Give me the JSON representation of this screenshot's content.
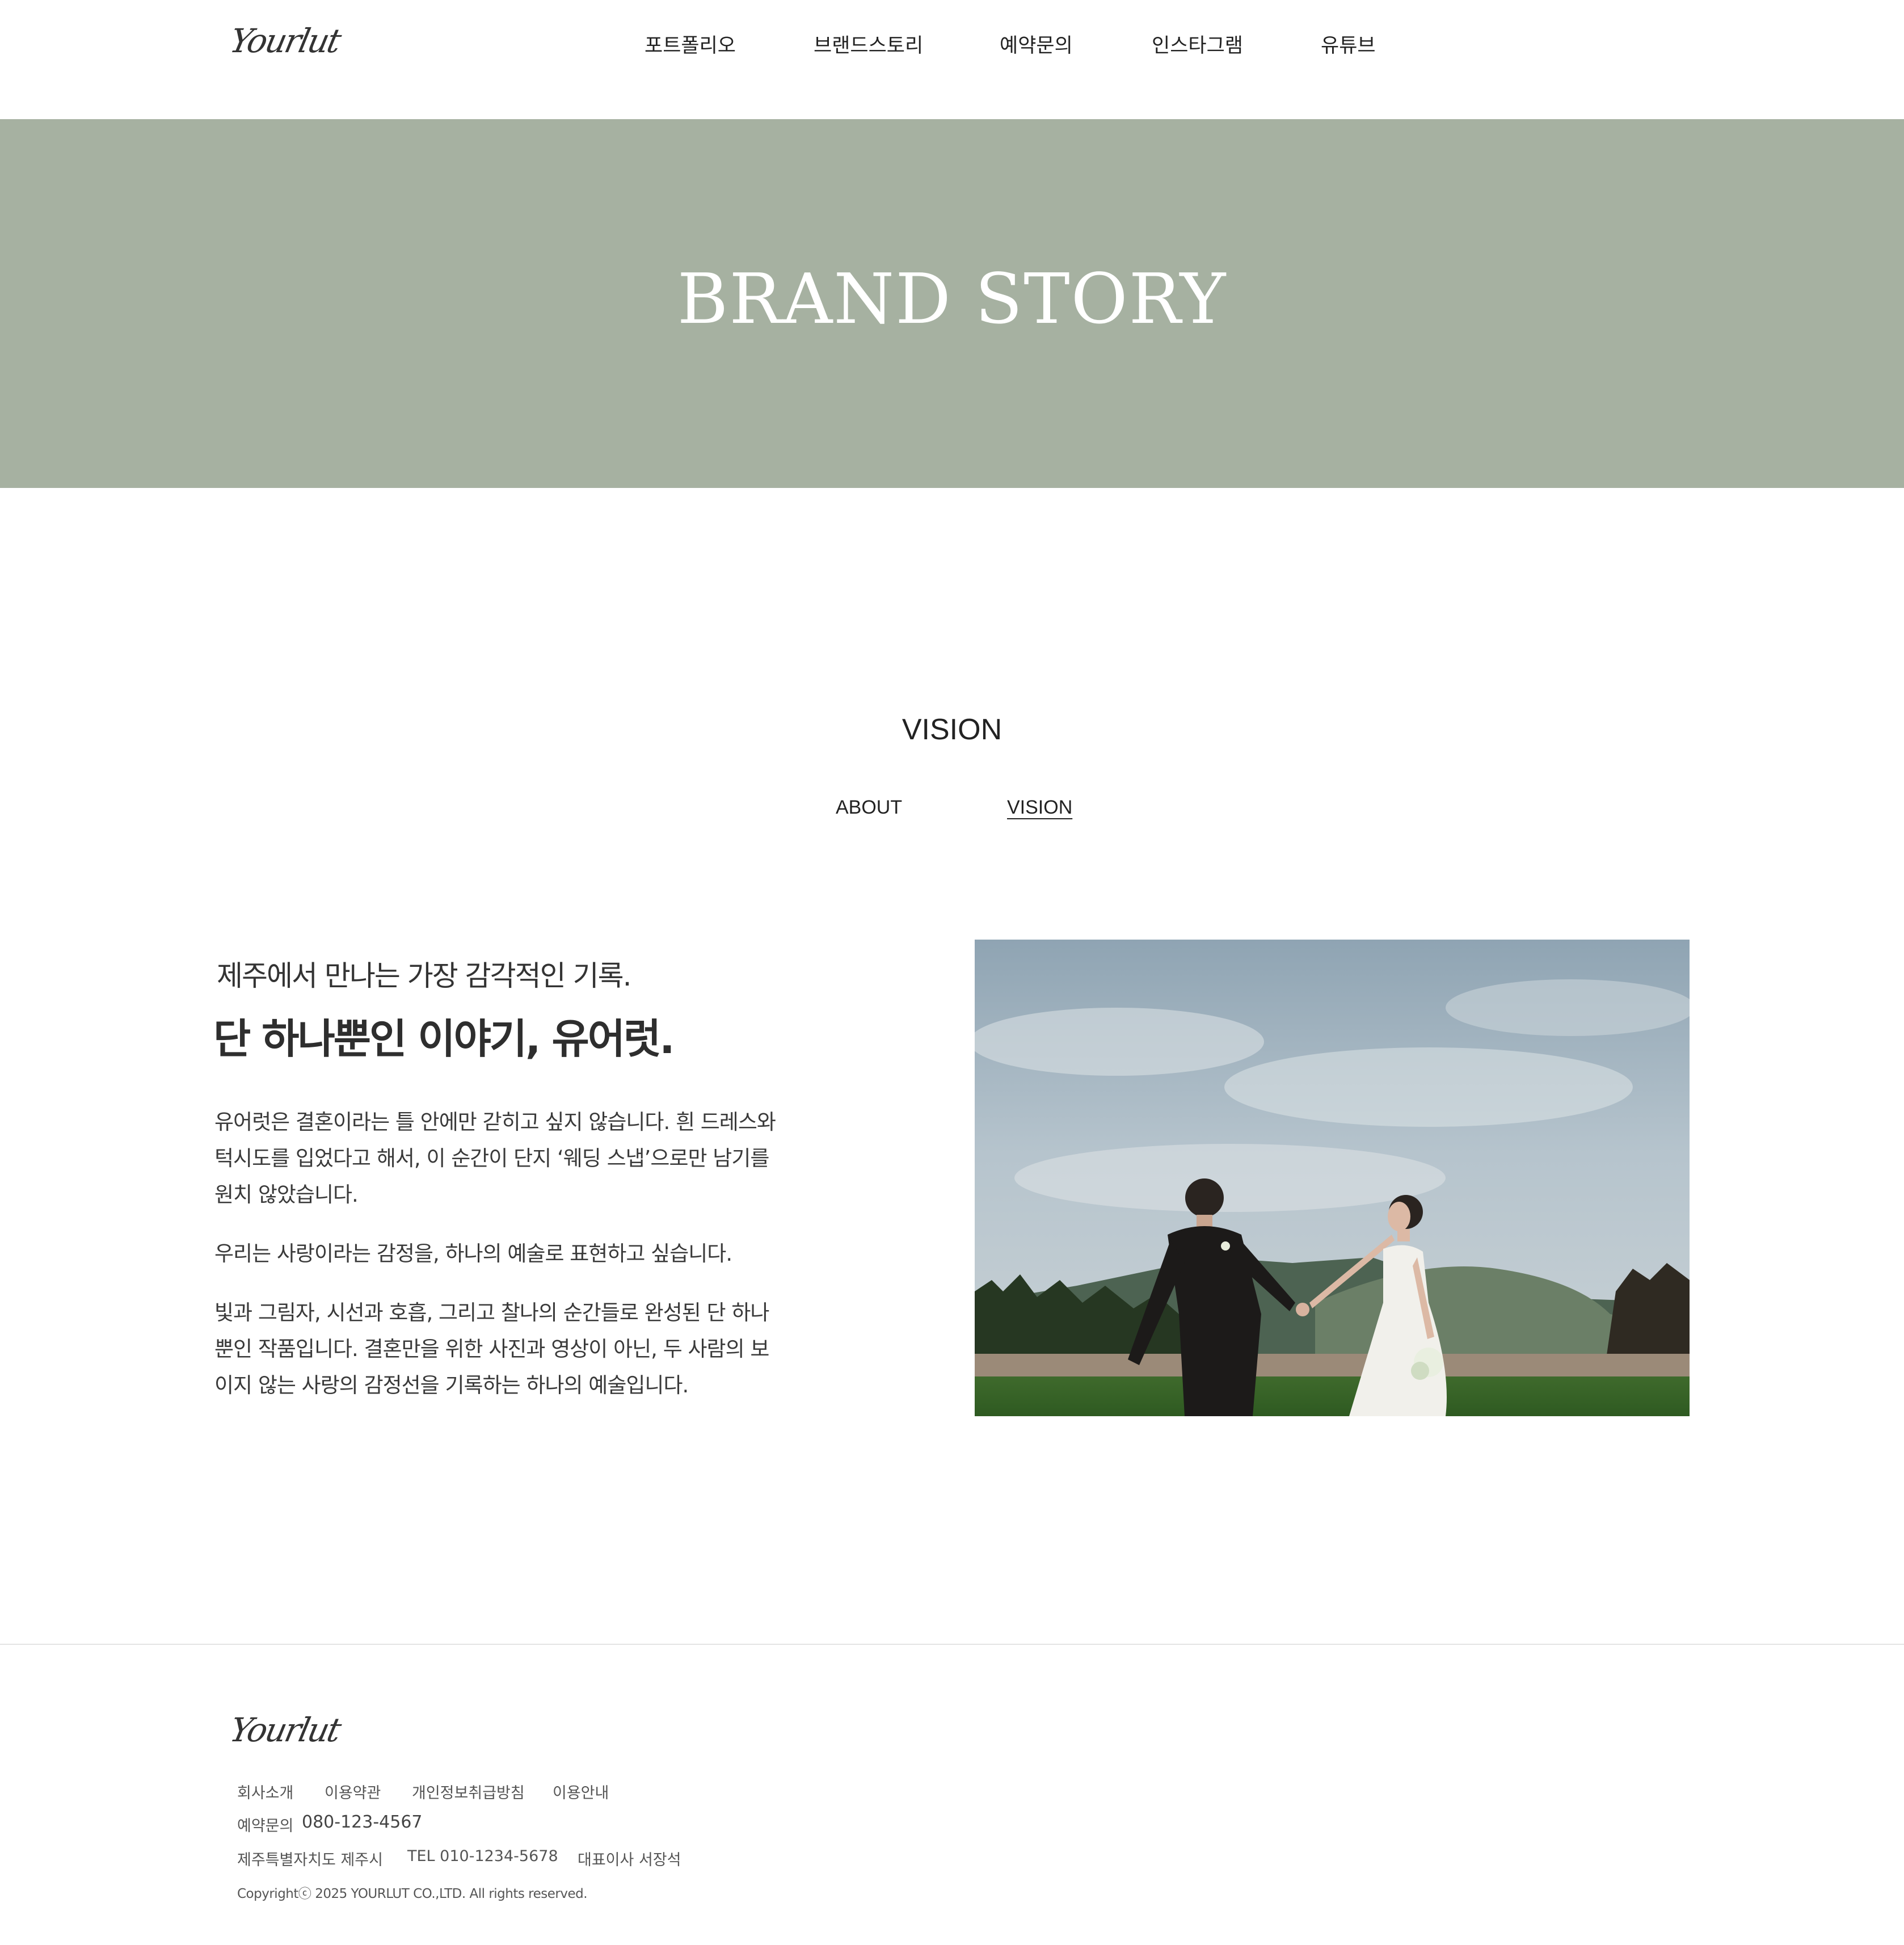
{
  "header": {
    "logo_text": "Yourlut",
    "nav": [
      "포트폴리오",
      "브랜드스토리",
      "예약문의",
      "인스타그램",
      "유튜브"
    ]
  },
  "hero": {
    "title": "BRAND STORY",
    "background_color": "#a6b1a1"
  },
  "section": {
    "title": "VISION",
    "tabs": [
      {
        "label": "ABOUT",
        "active": false
      },
      {
        "label": "VISION",
        "active": true
      }
    ]
  },
  "content": {
    "sub_heading": "제주에서 만나는 가장 감각적인 기록.",
    "main_heading": "단 하나뿐인 이야기, 유어럿.",
    "paragraphs": [
      "유어럿은 결혼이라는 틀 안에만 갇히고 싶지 않습니다. 흰 드레스와 턱시도를 입었다고 해서, 이 순간이 단지 ‘웨딩 스냅’으로만 남기를 원치 않았습니다.",
      "우리는 사랑이라는 감정을, 하나의 예술로 표현하고 싶습니다.",
      "빛과 그림자, 시선과 호흡, 그리고 찰나의 순간들로 완성된 단 하나뿐인 작품입니다. 결혼만을 위한 사진과 영상이 아닌, 두 사람의 보이지 않는 사랑의 감정선을 기록하는 하나의 예술입니다."
    ]
  },
  "footer": {
    "logo_text": "Yourlut",
    "links": [
      "회사소개",
      "이용약관",
      "개인정보취급방침",
      "이용안내"
    ],
    "reservation_label": "예약문의",
    "reservation_phone": "080-123-4567",
    "address": "제주특별자치도 제주시",
    "tel": "TEL 010-1234-5678",
    "ceo": "대표이사 서장석",
    "copyright": "Copyrightⓒ 2025 YOURLUT CO.,LTD. All rights reserved."
  }
}
